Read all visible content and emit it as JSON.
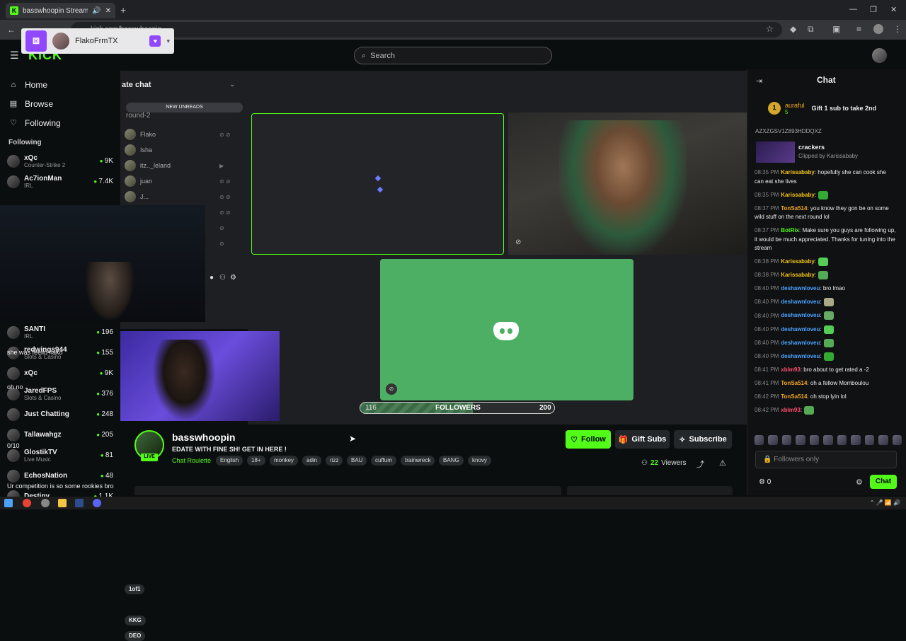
{
  "browser": {
    "tab_title": "basswhoopin Stream - Watch",
    "url": "kick.com/basswhoopin",
    "new_tab": "+"
  },
  "twitch_overlay": {
    "username": "FlakoFrmTX"
  },
  "site": {
    "logo": "KICK",
    "search_placeholder": "Search"
  },
  "nav": [
    {
      "label": "Home",
      "icon": "home-icon"
    },
    {
      "label": "Browse",
      "icon": "browse-icon"
    },
    {
      "label": "Following",
      "icon": "heart-icon"
    }
  ],
  "following_header": "Following",
  "following": [
    {
      "name": "xQc",
      "category": "Counter-Strike 2",
      "viewers": "9K"
    },
    {
      "name": "Ac7ionMan",
      "category": "IRL",
      "viewers": "7.4K"
    }
  ],
  "discord": {
    "header": "ate chat",
    "new_unreads": "NEW UNREADS",
    "channel": "round-2",
    "users": [
      {
        "name": "Flako",
        "tag": "1of1"
      },
      {
        "name": "Isha",
        "tag": ""
      },
      {
        "name": "itz.._leland",
        "tag": "KKG"
      },
      {
        "name": "juan",
        "tag": "DEO"
      },
      {
        "name": "J...",
        "tag": ""
      }
    ]
  },
  "overlay_channels": [
    {
      "name": "SANTI",
      "category": "IRL",
      "viewers": "196"
    },
    {
      "name": "redwings944",
      "category": "Slots & Casino",
      "viewers": "155"
    },
    {
      "name": "xQc",
      "category": "",
      "viewers": "9K"
    },
    {
      "name": "JaredFPS",
      "category": "Slots & Casino",
      "viewers": "376"
    },
    {
      "name": "Just Chatting",
      "category": "",
      "viewers": "248"
    },
    {
      "name": "Tallawahgz",
      "category": "",
      "viewers": "205"
    },
    {
      "name": "GlostikTV",
      "category": "Live Music",
      "viewers": "81"
    },
    {
      "name": "EchosNation",
      "category": "",
      "viewers": "48"
    },
    {
      "name": "Destiny",
      "category": "",
      "viewers": "1.1K"
    }
  ],
  "overlay_msgs": [
    "she was feelin flako",
    "oh no",
    "0/10",
    "Ur competition is so some rookies bro"
  ],
  "followers_goal": {
    "current": "116",
    "label": "FOLLOWERS",
    "goal": "200",
    "progress": 0.58
  },
  "stream": {
    "name": "basswhoopin",
    "live": "LIVE",
    "title": "EDATE WITH FINE SH! GET IN HERE !",
    "category": "Chat Roulette",
    "tags": [
      "English",
      "18+",
      "monkey",
      "adin",
      "rizz",
      "BAU",
      "cuffum",
      "trainwreck",
      "BANG",
      "knovy"
    ],
    "viewers": "22",
    "viewers_label": "Viewers"
  },
  "buttons": {
    "follow": "Follow",
    "gift": "Gift Subs",
    "subscribe": "Subscribe"
  },
  "chat": {
    "header": "Chat",
    "pinned_name": "auraful",
    "pinned_count": "5",
    "pinned_rank": "1",
    "gift_text": "Gift 1 sub to take 2nd",
    "clip_link": "AZXZGSV1Z893HDDQXZ",
    "clip_title": "crackers",
    "clip_by": "Clipped by Karissababy",
    "messages": [
      {
        "time": "08:35 PM",
        "user": "Karissababy",
        "color": "#f5c518",
        "text": ": hopefully she can cook she can eat she lives"
      },
      {
        "time": "08:35 PM",
        "user": "Karissababy",
        "color": "#f5c518",
        "text": ":"
      },
      {
        "time": "08:37 PM",
        "user": "TonSa514",
        "color": "#f5a623",
        "text": ": you know they gon be on some wild stuff on the next round lol"
      },
      {
        "time": "08:37 PM",
        "user": "BotRix",
        "color": "#53fc18",
        "text": ": Make sure you guys are following up, it would be much appreciated. Thanks for tuning into the stream"
      },
      {
        "time": "08:38 PM",
        "user": "Karissababy",
        "color": "#f5c518",
        "text": ":"
      },
      {
        "time": "08:38 PM",
        "user": "Karissababy",
        "color": "#f5c518",
        "text": ":"
      },
      {
        "time": "08:40 PM",
        "user": "deshawnloveu",
        "color": "#4aa3ff",
        "text": ": bro lmao"
      },
      {
        "time": "08:40 PM",
        "user": "deshawnloveu",
        "color": "#4aa3ff",
        "text": ":"
      },
      {
        "time": "08:40 PM",
        "user": "deshawnloveu",
        "color": "#4aa3ff",
        "text": ":"
      },
      {
        "time": "08:40 PM",
        "user": "deshawnloveu",
        "color": "#4aa3ff",
        "text": ":"
      },
      {
        "time": "08:40 PM",
        "user": "deshawnloveu",
        "color": "#4aa3ff",
        "text": ":"
      },
      {
        "time": "08:40 PM",
        "user": "deshawnloveu",
        "color": "#4aa3ff",
        "text": ":"
      },
      {
        "time": "08:41 PM",
        "user": "xblm93",
        "color": "#ff4d6d",
        "text": ": bro about to get rated a -2"
      },
      {
        "time": "08:41 PM",
        "user": "TonSa514",
        "color": "#f5a623",
        "text": ": oh a fellow Momboulou"
      },
      {
        "time": "08:42 PM",
        "user": "TonSa514",
        "color": "#f5a623",
        "text": ": oh stop lyin lol"
      },
      {
        "time": "08:42 PM",
        "user": "xblm93",
        "color": "#ff4d6d",
        "text": ":"
      }
    ],
    "input_placeholder": "Followers only",
    "points": "0",
    "send": "Chat"
  }
}
